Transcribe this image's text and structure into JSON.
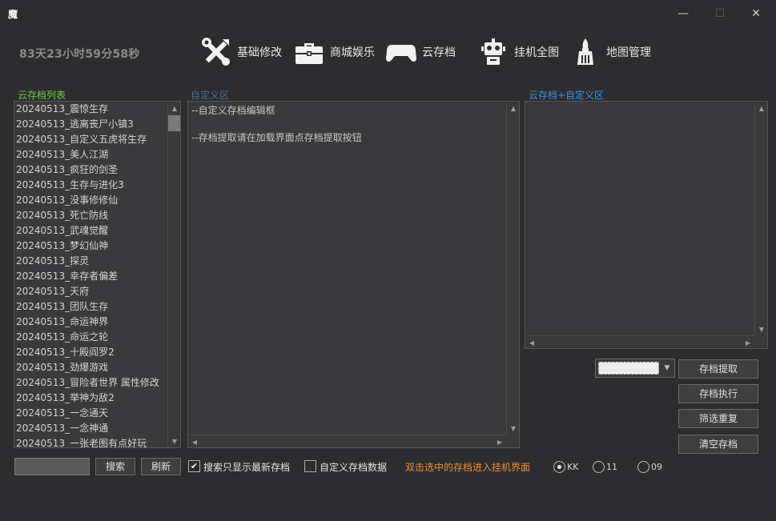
{
  "window": {
    "app_icon": "魔",
    "minimize_glyph": "—",
    "maximize_glyph": "☐",
    "close_glyph": "✕"
  },
  "timer": "83天23小时59分58秒",
  "nav": [
    {
      "label": "基础修改",
      "icon": "tools-icon"
    },
    {
      "label": "商城娱乐",
      "icon": "briefcase-icon"
    },
    {
      "label": "云存档",
      "icon": "gamepad-icon"
    },
    {
      "label": "挂机全图",
      "icon": "robot-icon"
    },
    {
      "label": "地图管理",
      "icon": "brush-icon"
    }
  ],
  "sections": {
    "cloud_list": "云存档列表",
    "custom_area": "自定义区",
    "cloud_custom_area": "云存档+自定义区"
  },
  "save_list": [
    "20240513_震惊生存",
    "20240513_逃离丧尸小镇3",
    "20240513_自定义五虎将生存",
    "20240513_美人江湖",
    "20240513_疯狂的剑圣",
    "20240513_生存与进化3",
    "20240513_没事修修仙",
    "20240513_死亡防线",
    "20240513_武魂觉醒",
    "20240513_梦幻仙神",
    "20240513_探灵",
    "20240513_幸存者偏差",
    "20240513_天府",
    "20240513_团队生存",
    "20240513_命运神界",
    "20240513_命运之轮",
    "20240513_十殿阎罗2",
    "20240513_劲爆游戏",
    "20240513_冒险者世界 属性修改",
    "20240513_举神为敌2",
    "20240513_一念通天",
    "20240513_一念神通",
    "20240513_一张老图有点好玩"
  ],
  "editor_text": "--自定义存档编辑框\n\n--存档提取请在加载界面点存档提取按钮",
  "buttons": {
    "extract": "存档提取",
    "execute": "存档执行",
    "filter_reset": "筛选重复",
    "clear": "清空存档",
    "search": "搜索",
    "refresh": "刷新"
  },
  "checkboxes": {
    "latest_only": {
      "label": "搜索只显示最新存档",
      "checked": true
    },
    "custom_data": {
      "label": "自定义存档数据",
      "checked": false
    }
  },
  "hint": "双击选中的存档进入挂机界面",
  "radios": [
    {
      "label": "KK",
      "selected": true
    },
    {
      "label": "11",
      "selected": false
    },
    {
      "label": "09",
      "selected": false
    }
  ],
  "colors": {
    "background": "#2d2d30",
    "panel": "#3a3a3c",
    "green_label": "#6ecb3b",
    "blue_label": "#3d8fe6",
    "orange_hint": "#f08a30"
  }
}
